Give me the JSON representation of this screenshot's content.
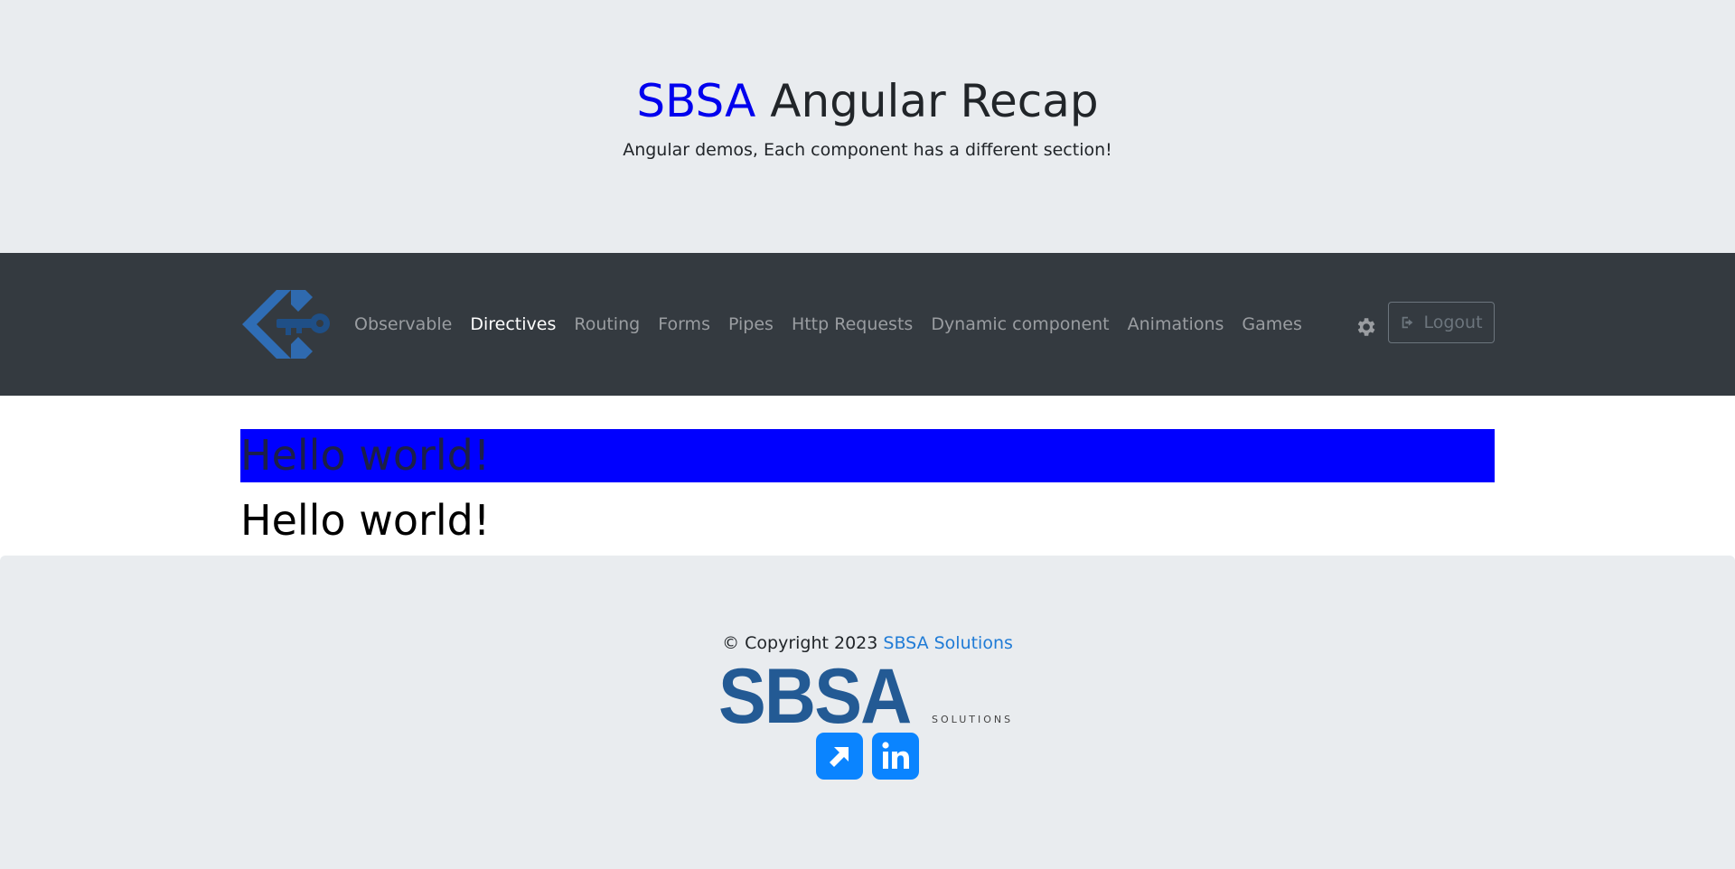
{
  "header": {
    "brand": "SBSA",
    "title_rest": " Angular Recap",
    "subtitle": "Angular demos, Each component has a different section!"
  },
  "navbar": {
    "logo_icon": "key-diamond-logo",
    "links": [
      {
        "label": "Observable",
        "active": false
      },
      {
        "label": "Directives",
        "active": true
      },
      {
        "label": "Routing",
        "active": false
      },
      {
        "label": "Forms",
        "active": false
      },
      {
        "label": "Pipes",
        "active": false
      },
      {
        "label": "Http Requests",
        "active": false
      },
      {
        "label": "Dynamic component",
        "active": false
      },
      {
        "label": "Animations",
        "active": false
      },
      {
        "label": "Games",
        "active": false
      }
    ],
    "settings_icon": "gear-icon",
    "logout_label": "Logout",
    "logout_icon": "sign-out-icon"
  },
  "main": {
    "highlighted_heading": "Hello world!",
    "plain_heading": "Hello world!",
    "highlight_color": "#0000ff"
  },
  "footer": {
    "copyright_prefix": "© Copyright 2023 ",
    "company_link": "SBSA Solutions",
    "logo_main": "SBSA",
    "logo_sub": "SOLUTIONS",
    "social": [
      {
        "icon": "external-link-icon"
      },
      {
        "icon": "linkedin-icon"
      }
    ]
  },
  "colors": {
    "brand_blue": "#0000ee",
    "navbar_bg": "#343a40",
    "jumbotron_bg": "#e9ecef",
    "link_blue": "#1f7bd6",
    "logo_blue": "#235a94",
    "social_blue": "#0a84ff"
  }
}
